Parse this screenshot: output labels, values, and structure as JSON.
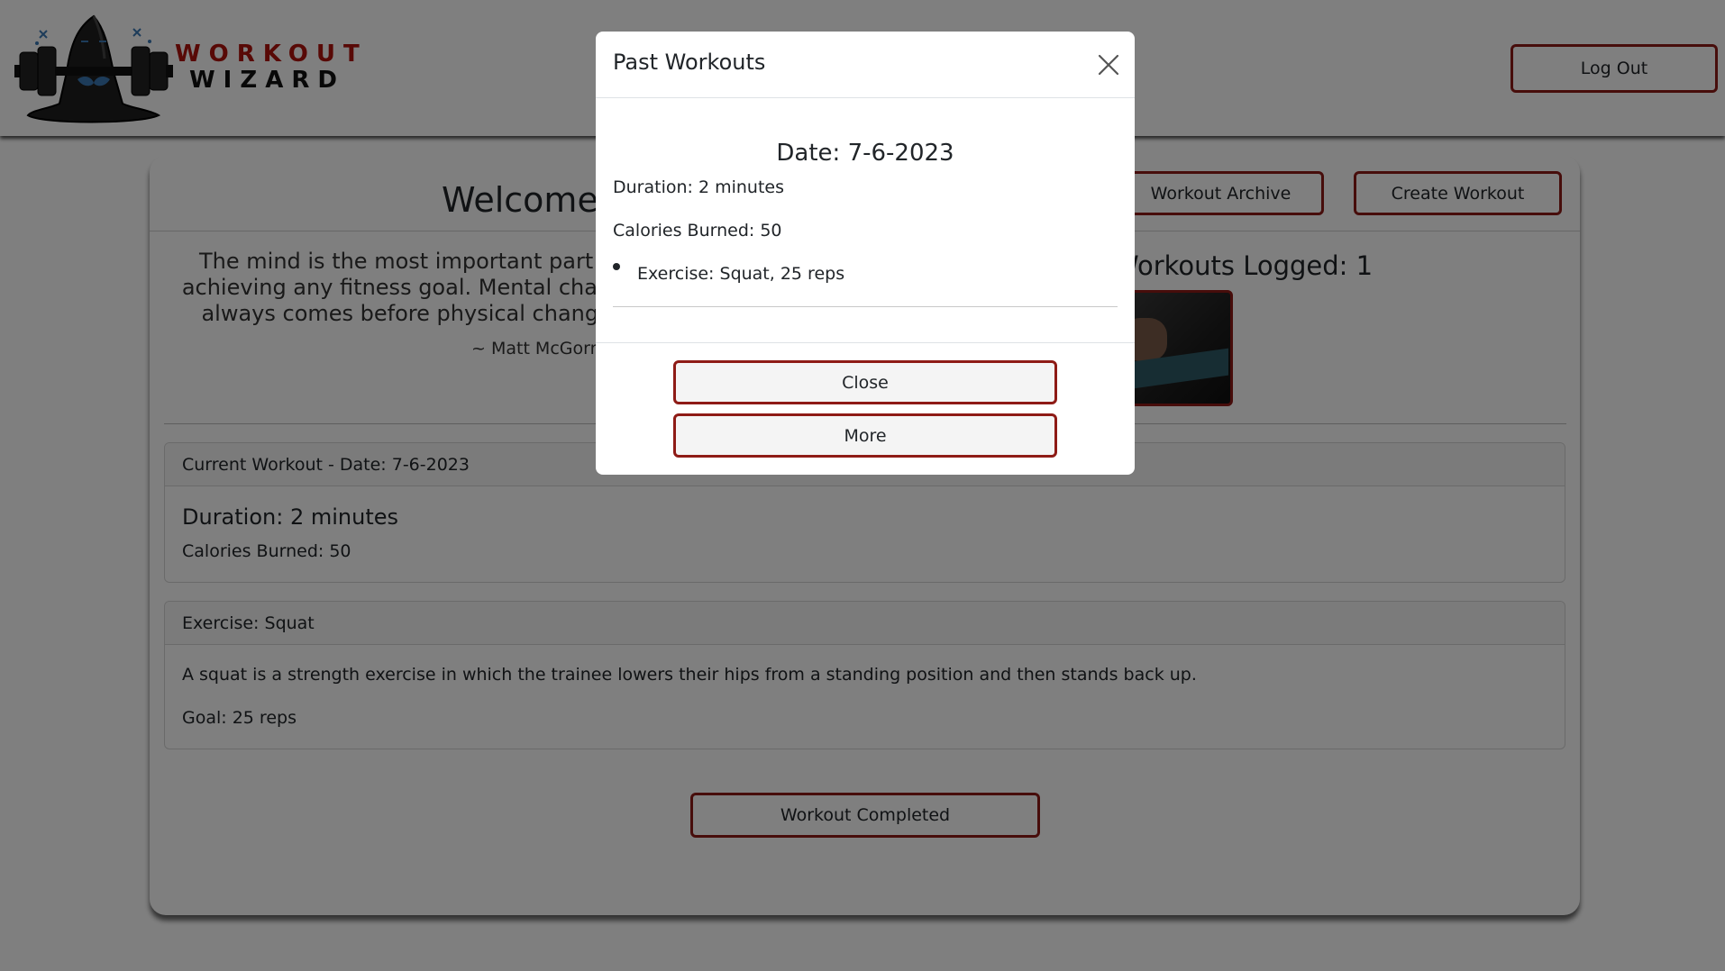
{
  "header": {
    "logo_line1": "WORKOUT",
    "logo_line2": "WIZARD",
    "logout_label": "Log Out"
  },
  "main": {
    "welcome": "Welcome",
    "archive_label": "Workout Archive",
    "create_label": "Create Workout",
    "quote": "The mind is the most important part of achieving any fitness goal. Mental change always comes before physical change.",
    "quote_author": "~ Matt McGorry",
    "logged_text": "Workouts Logged: 1",
    "current_workout": {
      "header": "Current Workout - Date: 7-6-2023",
      "duration": "Duration: 2 minutes",
      "calories": "Calories Burned: 50"
    },
    "exercise": {
      "header": "Exercise: Squat",
      "description": "A squat is a strength exercise in which the trainee lowers their hips from a standing position and then stands back up.",
      "goal": "Goal: 25 reps"
    },
    "complete_label": "Workout Completed"
  },
  "modal": {
    "title": "Past Workouts",
    "date": "Date: 7-6-2023",
    "duration": "Duration: 2 minutes",
    "calories": "Calories Burned: 50",
    "exercise_item": "Exercise: Squat, 25 reps",
    "close_label": "Close",
    "more_label": "More"
  },
  "colors": {
    "accent": "#8e1b16",
    "logo_red": "#b0120d",
    "overlay": "rgba(0,0,0,0.5)"
  },
  "icons": [
    "wizard-hat-dumbbell-logo",
    "close-icon"
  ]
}
